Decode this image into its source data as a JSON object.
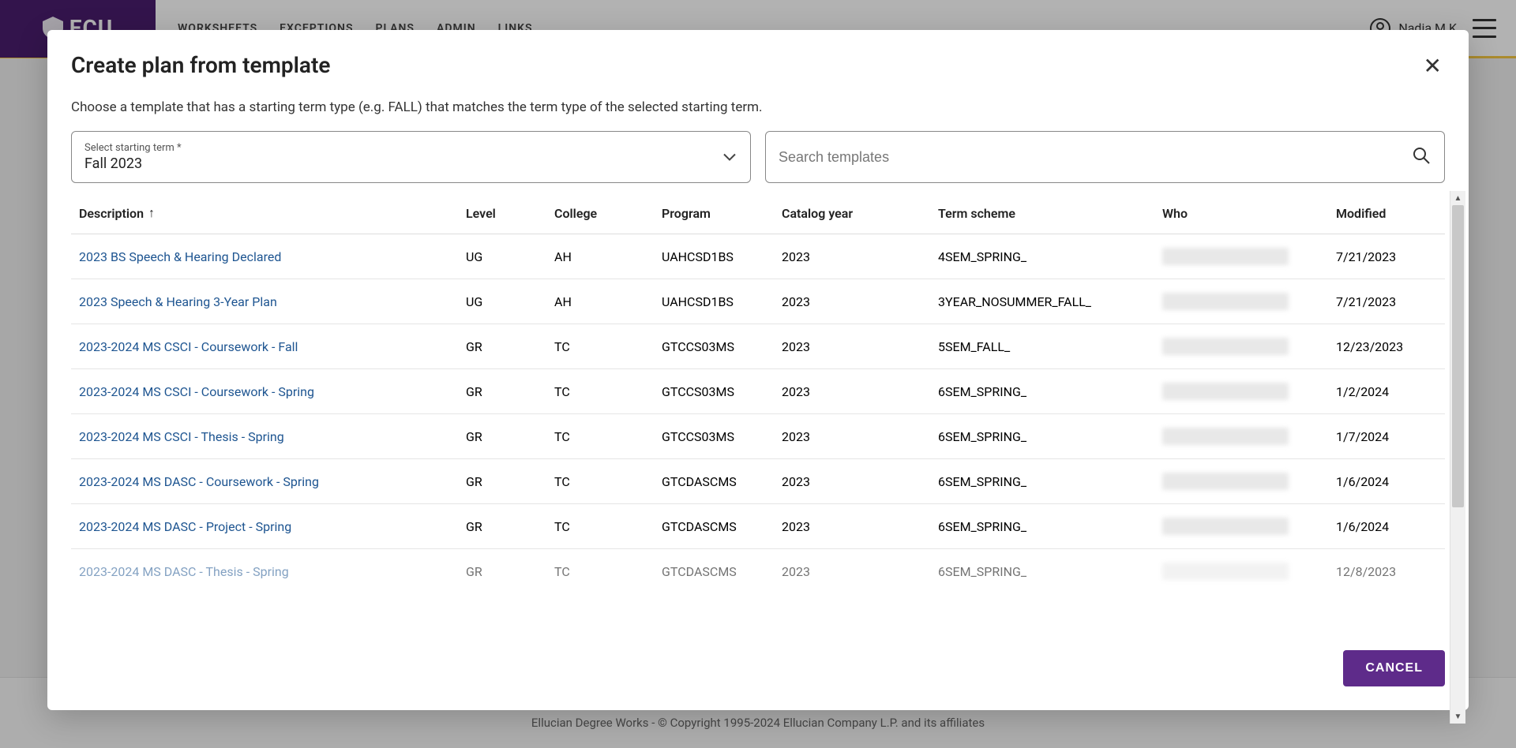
{
  "header": {
    "logo_text": "ECU",
    "nav": [
      "WORKSHEETS",
      "EXCEPTIONS",
      "PLANS",
      "ADMIN",
      "LINKS"
    ],
    "user_name": "Nadia M K"
  },
  "footer": {
    "copyright": "Ellucian Degree Works - © Copyright 1995-2024 Ellucian Company L.P. and its affiliates"
  },
  "modal": {
    "title": "Create plan from template",
    "instruction": "Choose a template that has a starting term type (e.g. FALL) that matches the term type of the selected starting term.",
    "select": {
      "label": "Select starting term *",
      "value": "Fall 2023"
    },
    "search": {
      "placeholder": "Search templates"
    },
    "columns": {
      "description": "Description",
      "level": "Level",
      "college": "College",
      "program": "Program",
      "catalog_year": "Catalog year",
      "term_scheme": "Term scheme",
      "who": "Who",
      "modified": "Modified"
    },
    "rows": [
      {
        "desc": "2023 BS Speech & Hearing Declared",
        "level": "UG",
        "college": "AH",
        "program": "UAHCSD1BS",
        "catalog": "2023",
        "term": "4SEM_SPRING_",
        "modified": "7/21/2023"
      },
      {
        "desc": "2023 Speech & Hearing 3-Year Plan",
        "level": "UG",
        "college": "AH",
        "program": "UAHCSD1BS",
        "catalog": "2023",
        "term": "3YEAR_NOSUMMER_FALL_",
        "modified": "7/21/2023"
      },
      {
        "desc": "2023-2024 MS CSCI - Coursework - Fall",
        "level": "GR",
        "college": "TC",
        "program": "GTCCS03MS",
        "catalog": "2023",
        "term": "5SEM_FALL_",
        "modified": "12/23/2023"
      },
      {
        "desc": "2023-2024 MS CSCI - Coursework - Spring",
        "level": "GR",
        "college": "TC",
        "program": "GTCCS03MS",
        "catalog": "2023",
        "term": "6SEM_SPRING_",
        "modified": "1/2/2024"
      },
      {
        "desc": "2023-2024 MS CSCI - Thesis - Spring",
        "level": "GR",
        "college": "TC",
        "program": "GTCCS03MS",
        "catalog": "2023",
        "term": "6SEM_SPRING_",
        "modified": "1/7/2024"
      },
      {
        "desc": "2023-2024 MS DASC - Coursework - Spring",
        "level": "GR",
        "college": "TC",
        "program": "GTCDASCMS",
        "catalog": "2023",
        "term": "6SEM_SPRING_",
        "modified": "1/6/2024"
      },
      {
        "desc": "2023-2024 MS DASC - Project - Spring",
        "level": "GR",
        "college": "TC",
        "program": "GTCDASCMS",
        "catalog": "2023",
        "term": "6SEM_SPRING_",
        "modified": "1/6/2024"
      },
      {
        "desc": "2023-2024 MS DASC - Thesis - Spring",
        "level": "GR",
        "college": "TC",
        "program": "GTCDASCMS",
        "catalog": "2023",
        "term": "6SEM_SPRING_",
        "modified": "12/8/2023"
      }
    ],
    "cancel_label": "CANCEL"
  }
}
